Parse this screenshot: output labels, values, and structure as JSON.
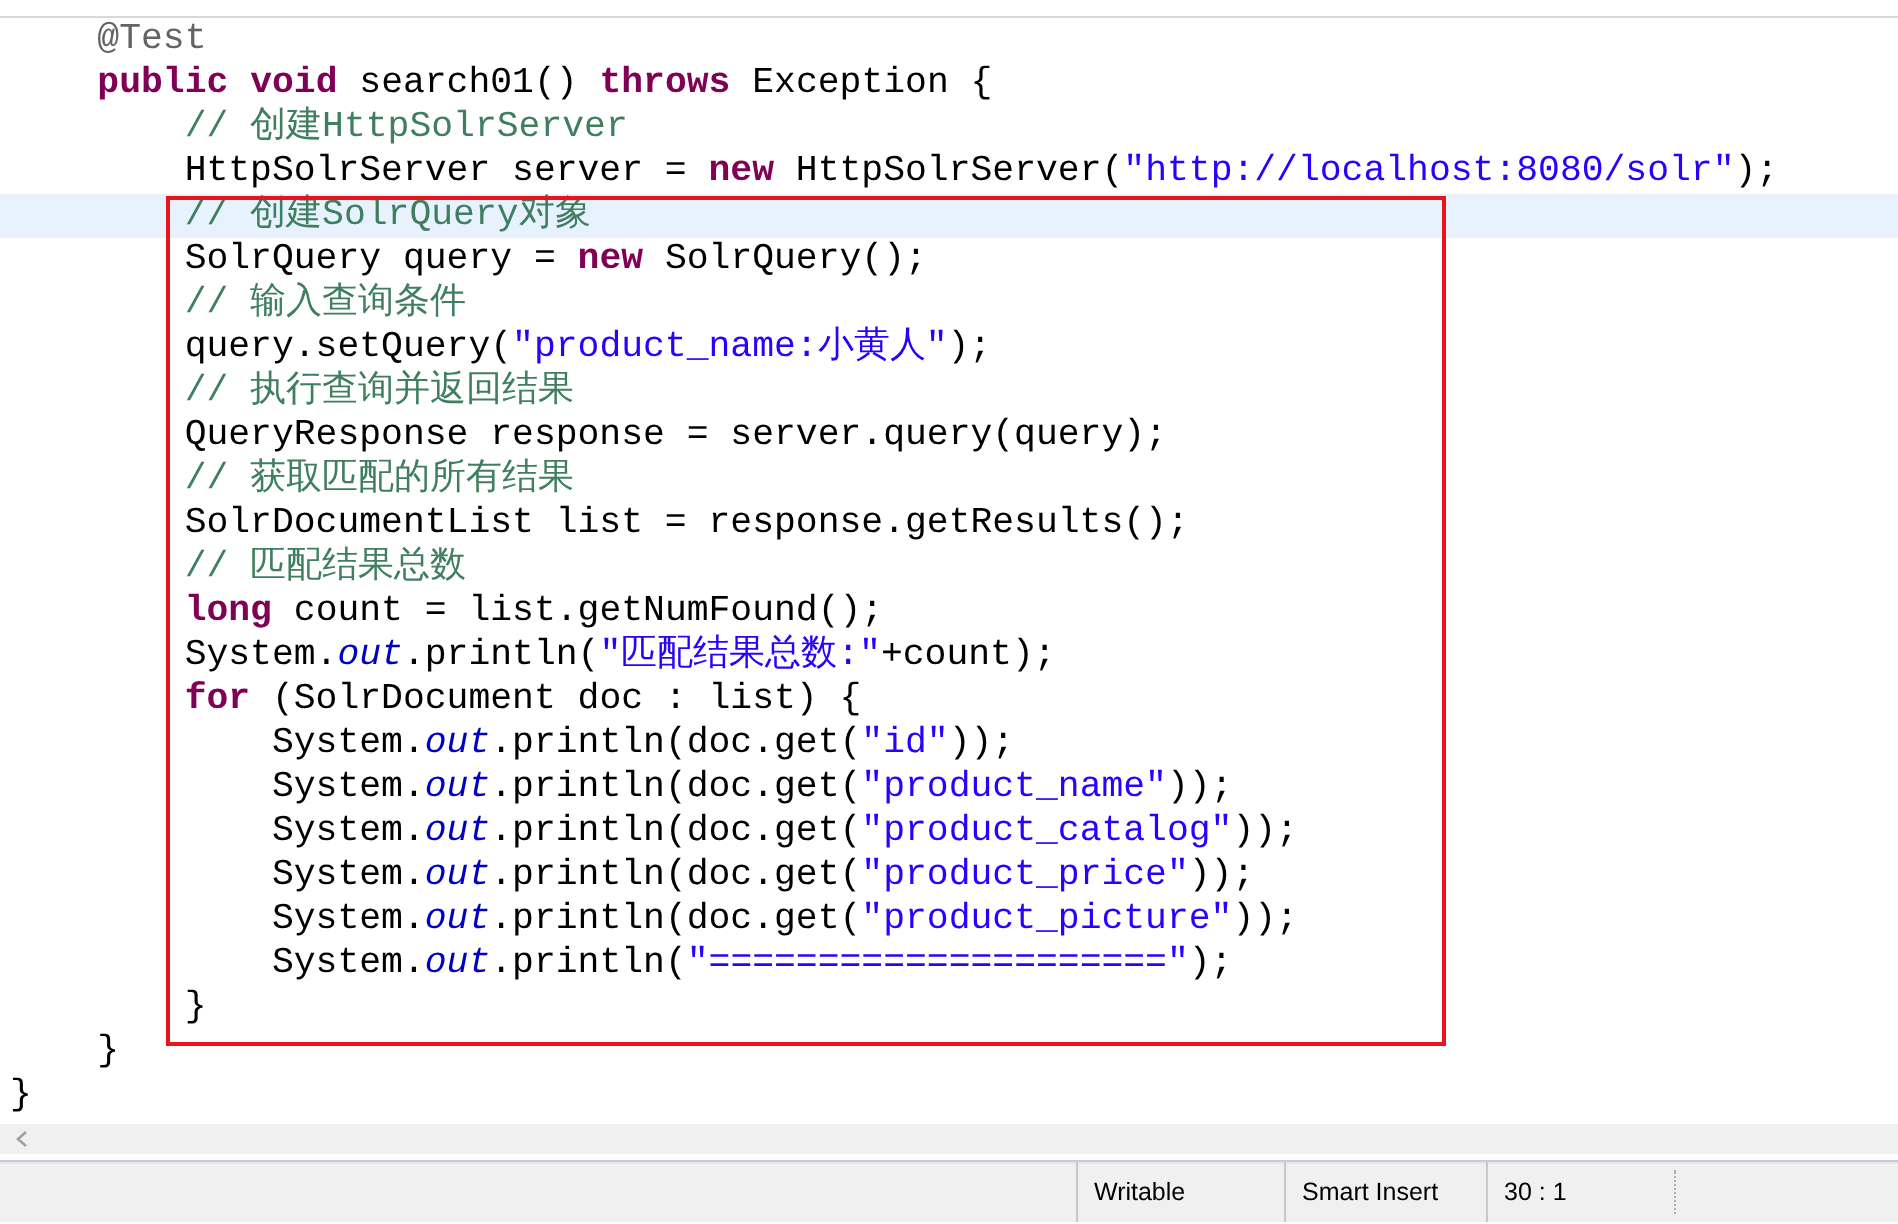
{
  "editor": {
    "lines_before": [
      {
        "current": false,
        "tokens": [
          {
            "kind": "annotation",
            "text": "    @Test"
          }
        ]
      },
      {
        "current": false,
        "tokens": [
          {
            "kind": "keyword",
            "text": "    public"
          },
          {
            "kind": "keyword",
            "text": " void"
          },
          {
            "kind": "plain",
            "text": " search01() "
          },
          {
            "kind": "keyword",
            "text": "throws"
          },
          {
            "kind": "plain",
            "text": " Exception {"
          }
        ]
      },
      {
        "current": false,
        "tokens": [
          {
            "kind": "comment",
            "text": "        // 创建HttpSolrServer"
          }
        ]
      },
      {
        "current": false,
        "tokens": [
          {
            "kind": "plain",
            "text": "        HttpSolrServer server = "
          },
          {
            "kind": "keyword",
            "text": "new"
          },
          {
            "kind": "plain",
            "text": " HttpSolrServer("
          },
          {
            "kind": "string",
            "text": "\"http://localhost:8080/solr\""
          },
          {
            "kind": "plain",
            "text": ");"
          }
        ]
      }
    ],
    "boxed_lines": [
      {
        "current": true,
        "tokens": [
          {
            "kind": "comment",
            "text": "        // 创建SolrQuery对象"
          }
        ]
      },
      {
        "current": false,
        "tokens": [
          {
            "kind": "plain",
            "text": "        SolrQuery query = "
          },
          {
            "kind": "keyword",
            "text": "new"
          },
          {
            "kind": "plain",
            "text": " SolrQuery();"
          }
        ]
      },
      {
        "current": false,
        "tokens": [
          {
            "kind": "comment",
            "text": "        // 输入查询条件"
          }
        ]
      },
      {
        "current": false,
        "tokens": [
          {
            "kind": "plain",
            "text": "        query.setQuery("
          },
          {
            "kind": "string",
            "text": "\"product_name:小黄人\""
          },
          {
            "kind": "plain",
            "text": ");"
          }
        ]
      },
      {
        "current": false,
        "tokens": [
          {
            "kind": "comment",
            "text": "        // 执行查询并返回结果"
          }
        ]
      },
      {
        "current": false,
        "tokens": [
          {
            "kind": "plain",
            "text": "        QueryResponse response = server.query(query);"
          }
        ]
      },
      {
        "current": false,
        "tokens": [
          {
            "kind": "comment",
            "text": "        // 获取匹配的所有结果"
          }
        ]
      },
      {
        "current": false,
        "tokens": [
          {
            "kind": "plain",
            "text": "        SolrDocumentList list = response.getResults();"
          }
        ]
      },
      {
        "current": false,
        "tokens": [
          {
            "kind": "comment",
            "text": "        // 匹配结果总数"
          }
        ]
      },
      {
        "current": false,
        "tokens": [
          {
            "kind": "keyword",
            "text": "        long"
          },
          {
            "kind": "plain",
            "text": " count = list.getNumFound();"
          }
        ]
      },
      {
        "current": false,
        "tokens": [
          {
            "kind": "plain",
            "text": "        System."
          },
          {
            "kind": "static",
            "text": "out"
          },
          {
            "kind": "plain",
            "text": ".println("
          },
          {
            "kind": "string",
            "text": "\"匹配结果总数:\""
          },
          {
            "kind": "plain",
            "text": "+count);"
          }
        ]
      },
      {
        "current": false,
        "tokens": [
          {
            "kind": "keyword",
            "text": "        for"
          },
          {
            "kind": "plain",
            "text": " (SolrDocument doc : list) {"
          }
        ]
      },
      {
        "current": false,
        "tokens": [
          {
            "kind": "plain",
            "text": "            System."
          },
          {
            "kind": "static",
            "text": "out"
          },
          {
            "kind": "plain",
            "text": ".println(doc.get("
          },
          {
            "kind": "string",
            "text": "\"id\""
          },
          {
            "kind": "plain",
            "text": "));"
          }
        ]
      },
      {
        "current": false,
        "tokens": [
          {
            "kind": "plain",
            "text": "            System."
          },
          {
            "kind": "static",
            "text": "out"
          },
          {
            "kind": "plain",
            "text": ".println(doc.get("
          },
          {
            "kind": "string",
            "text": "\"product_name\""
          },
          {
            "kind": "plain",
            "text": "));"
          }
        ]
      },
      {
        "current": false,
        "tokens": [
          {
            "kind": "plain",
            "text": "            System."
          },
          {
            "kind": "static",
            "text": "out"
          },
          {
            "kind": "plain",
            "text": ".println(doc.get("
          },
          {
            "kind": "string",
            "text": "\"product_catalog\""
          },
          {
            "kind": "plain",
            "text": "));"
          }
        ]
      },
      {
        "current": false,
        "tokens": [
          {
            "kind": "plain",
            "text": "            System."
          },
          {
            "kind": "static",
            "text": "out"
          },
          {
            "kind": "plain",
            "text": ".println(doc.get("
          },
          {
            "kind": "string",
            "text": "\"product_price\""
          },
          {
            "kind": "plain",
            "text": "));"
          }
        ]
      },
      {
        "current": false,
        "tokens": [
          {
            "kind": "plain",
            "text": "            System."
          },
          {
            "kind": "static",
            "text": "out"
          },
          {
            "kind": "plain",
            "text": ".println(doc.get("
          },
          {
            "kind": "string",
            "text": "\"product_picture\""
          },
          {
            "kind": "plain",
            "text": "));"
          }
        ]
      },
      {
        "current": false,
        "tokens": [
          {
            "kind": "plain",
            "text": "            System."
          },
          {
            "kind": "static",
            "text": "out"
          },
          {
            "kind": "plain",
            "text": ".println("
          },
          {
            "kind": "string",
            "text": "\"=====================\""
          },
          {
            "kind": "plain",
            "text": ");"
          }
        ]
      },
      {
        "current": false,
        "tokens": [
          {
            "kind": "plain",
            "text": "        }"
          }
        ]
      }
    ],
    "lines_after": [
      {
        "current": false,
        "tokens": [
          {
            "kind": "plain",
            "text": "    }"
          }
        ]
      },
      {
        "current": false,
        "tokens": [
          {
            "kind": "plain",
            "text": "}"
          }
        ]
      }
    ]
  },
  "status_bar": {
    "fields": [
      "Writable",
      "Smart Insert",
      "30 : 1"
    ]
  }
}
